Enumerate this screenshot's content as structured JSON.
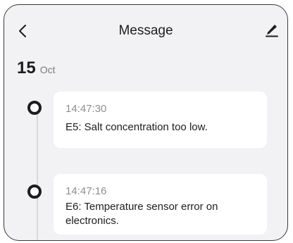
{
  "header": {
    "title": "Message",
    "back_icon": "chevron-left-icon",
    "edit_icon": "pencil-icon"
  },
  "date": {
    "day": "15",
    "month": "Oct"
  },
  "messages": [
    {
      "time": "14:47:30",
      "text": "E5: Salt concentration too low."
    },
    {
      "time": "14:47:16",
      "text": "E6: Temperature sensor error on electronics."
    }
  ],
  "colors": {
    "background": "#f2f2f5",
    "card": "#ffffff",
    "text": "#1d1d1f",
    "muted": "#8e8e93"
  }
}
